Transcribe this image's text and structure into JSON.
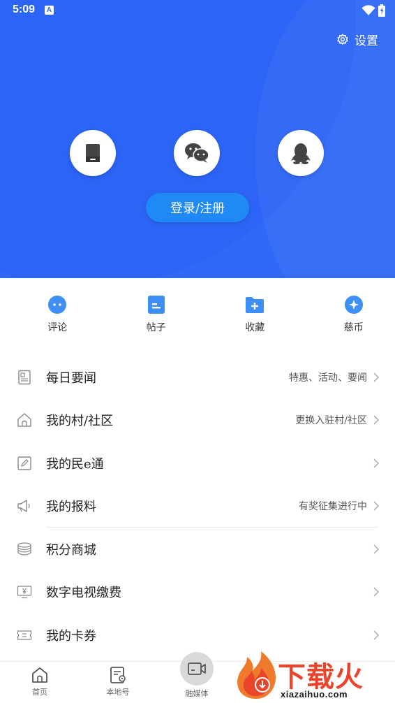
{
  "status_bar": {
    "time": "5:09",
    "notification_badge": "A"
  },
  "header": {
    "settings_label": "设置"
  },
  "login": {
    "social_icons": [
      "phone-icon",
      "wechat-icon",
      "qq-icon"
    ],
    "button_label": "登录/注册"
  },
  "quick_actions": [
    {
      "label": "评论",
      "icon": "comment-icon"
    },
    {
      "label": "帖子",
      "icon": "post-icon"
    },
    {
      "label": "收藏",
      "icon": "favorite-folder-icon"
    },
    {
      "label": "慈币",
      "icon": "coin-icon"
    }
  ],
  "menu": [
    {
      "title": "每日要闻",
      "hint": "特惠、活动、要闻",
      "icon": "newspaper-icon"
    },
    {
      "title": "我的村/社区",
      "hint": "更换入驻村/社区",
      "icon": "home-icon"
    },
    {
      "title": "我的民e通",
      "hint": "",
      "icon": "edit-icon"
    },
    {
      "title": "我的报料",
      "hint": "有奖征集进行中",
      "icon": "megaphone-icon"
    },
    {
      "title": "积分商城",
      "hint": "",
      "icon": "coins-stack-icon"
    },
    {
      "title": "数字电视缴费",
      "hint": "",
      "icon": "tv-yen-icon"
    },
    {
      "title": "我的卡券",
      "hint": "",
      "icon": "ticket-icon"
    }
  ],
  "tabbar": [
    {
      "label": "首页",
      "icon": "home-tab-icon"
    },
    {
      "label": "本地号",
      "icon": "local-account-icon"
    },
    {
      "label": "融媒体",
      "icon": "video-camera-icon"
    }
  ],
  "watermark": {
    "title": "下载火",
    "url": "xiazaihuo.com"
  },
  "colors": {
    "hero_blue": "#2f6af7",
    "login_button": "#1f8af5",
    "accent_icon": "#3d8ff6",
    "watermark_red": "#e8452c"
  }
}
